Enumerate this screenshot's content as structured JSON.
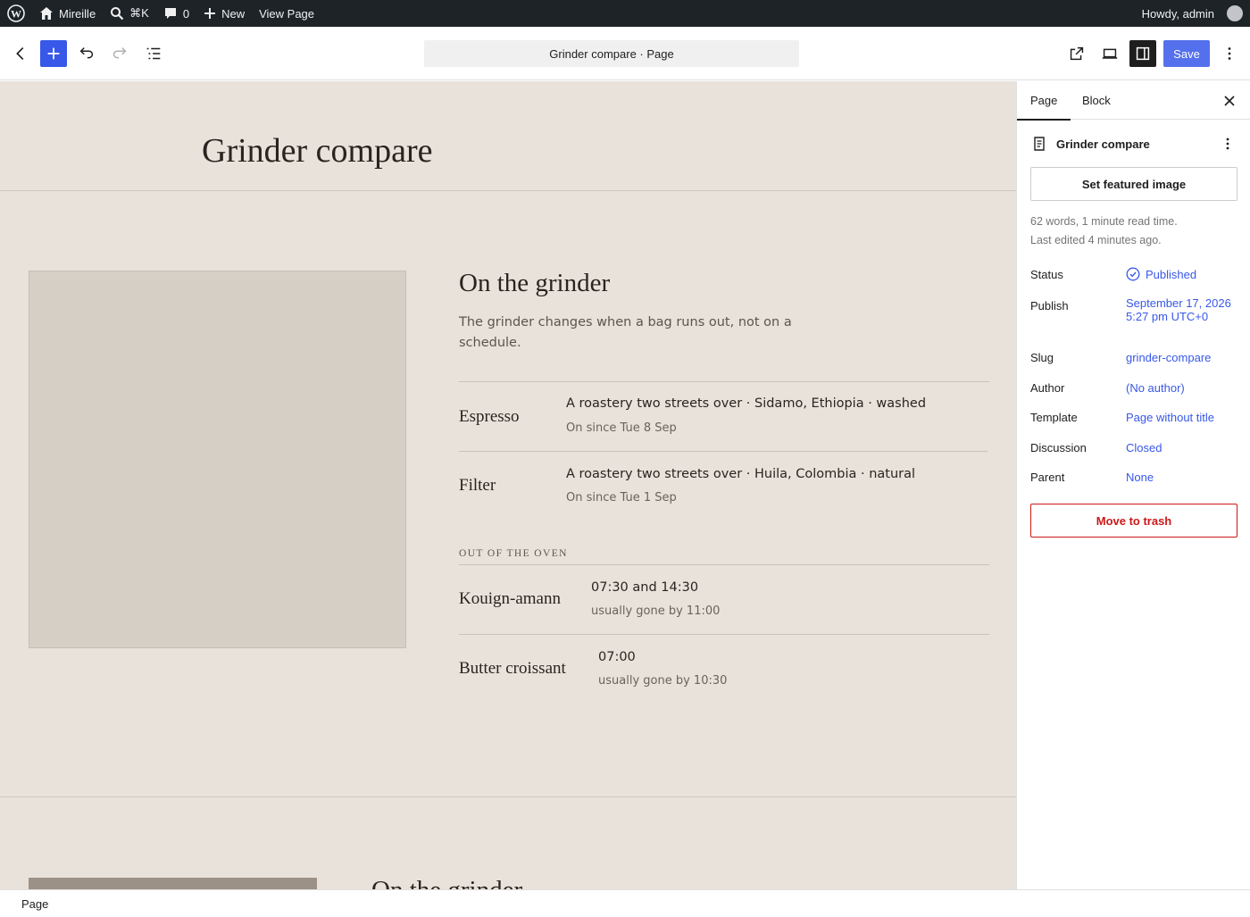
{
  "adminbar": {
    "site_name": "Mireille",
    "search_shortcut": "⌘K",
    "comments_count": "0",
    "new_label": "New",
    "view_page_label": "View Page",
    "greeting": "Howdy, admin"
  },
  "header": {
    "document_title": "Grinder compare · Page",
    "save_label": "Save"
  },
  "canvas": {
    "page_title": "Grinder compare",
    "section": {
      "heading": "On the grinder",
      "intro": "The grinder changes when a bag runs out, not on a schedule.",
      "rows": [
        {
          "name": "Espresso",
          "main": "A roastery two streets over · Sidamo, Ethiopia · washed",
          "sub": "On since Tue 8 Sep"
        },
        {
          "name": "Filter",
          "main": "A roastery two streets over · Huila, Colombia · natural",
          "sub": "On since Tue 1 Sep"
        }
      ],
      "oven_label": "OUT OF THE OVEN",
      "oven_rows": [
        {
          "name": "Kouign-amann",
          "main": "07:30 and 14:30",
          "sub": "usually gone by 11:00"
        },
        {
          "name": "Butter croissant",
          "main": "07:00",
          "sub": "usually gone by 10:30"
        }
      ]
    },
    "repeat_heading": "On the grinder"
  },
  "sidebar": {
    "tabs": [
      "Page",
      "Block"
    ],
    "doc_name": "Grinder compare",
    "featured_image_label": "Set featured image",
    "word_count": "62 words, 1 minute read time.",
    "last_edited": "Last edited 4 minutes ago.",
    "fields": [
      {
        "label": "Status",
        "value": "Published"
      },
      {
        "label": "Publish",
        "value": "September 17, 2026 5:27 pm UTC+0"
      },
      {
        "label": "Slug",
        "value": "grinder-compare"
      },
      {
        "label": "Author",
        "value": "(No author)"
      },
      {
        "label": "Template",
        "value": "Page without title"
      },
      {
        "label": "Discussion",
        "value": "Closed"
      },
      {
        "label": "Parent",
        "value": "None"
      }
    ],
    "trash_label": "Move to trash"
  },
  "footer": {
    "breadcrumb": "Page"
  },
  "colors": {
    "accent": "#3858e9",
    "canvas_bg": "#e8e2da",
    "danger": "#cc1818"
  }
}
